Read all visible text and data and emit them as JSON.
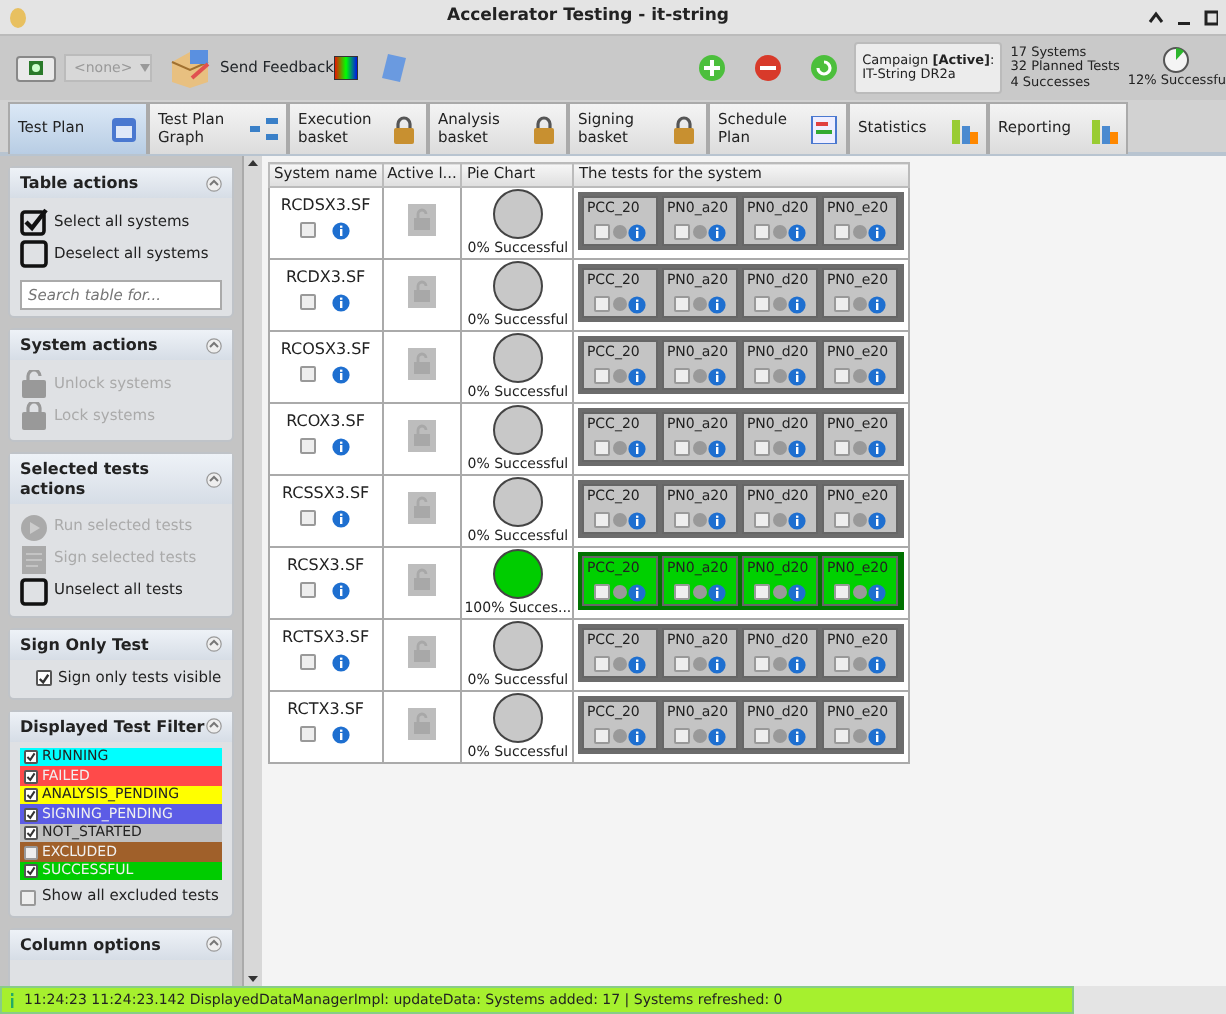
{
  "window": {
    "title": "Accelerator Testing - it-string"
  },
  "toolbar": {
    "dropdown": "<none>",
    "feedback": "Send Feedback",
    "campaign": "Campaign **[Active]**:",
    "campaign_name": "IT-String DR2a",
    "stats": [
      "17 Systems",
      "32 Planned Tests",
      "4 Successes"
    ],
    "progress_label": "12% Successfu"
  },
  "tabs": [
    {
      "label": "Test Plan",
      "selected": true
    },
    {
      "label": "Test Plan Graph",
      "selected": false
    },
    {
      "label": "Execution basket",
      "selected": false
    },
    {
      "label": "Analysis basket",
      "selected": false
    },
    {
      "label": "Signing basket",
      "selected": false
    },
    {
      "label": "Schedule Plan",
      "selected": false
    },
    {
      "label": "Statistics",
      "selected": false
    },
    {
      "label": "Reporting",
      "selected": false
    }
  ],
  "sidebar": {
    "table_actions": {
      "title": "Table actions",
      "select_all": "Select all systems",
      "deselect_all": "Deselect all systems",
      "search_placeholder": "Search table for..."
    },
    "system_actions": {
      "title": "System actions",
      "items": [
        {
          "label": "Unlock systems",
          "disabled": true
        },
        {
          "label": "Lock systems",
          "disabled": true
        }
      ]
    },
    "selected_tests_actions": {
      "title": "Selected tests actions",
      "items": [
        {
          "label": "Run selected tests",
          "disabled": true
        },
        {
          "label": "Sign selected tests",
          "disabled": true
        },
        {
          "label": "Unselect all tests",
          "disabled": false
        }
      ]
    },
    "sign_only": {
      "title": "Sign Only Test",
      "label": "Sign only tests visible",
      "checked": true
    },
    "filter": {
      "title": "Displayed Test Filter",
      "items": [
        {
          "label": "RUNNING",
          "checked": true,
          "color": "#00ffff"
        },
        {
          "label": "FAILED",
          "checked": true,
          "color": "#ff4a4a"
        },
        {
          "label": "ANALYSIS_PENDING",
          "checked": true,
          "color": "#ffff00"
        },
        {
          "label": "SIGNING_PENDING",
          "checked": true,
          "color": "#5c5ce6"
        },
        {
          "label": "NOT_STARTED",
          "checked": true,
          "color": "#c0c0c0"
        },
        {
          "label": "EXCLUDED",
          "checked": false,
          "color": "#a0602a"
        },
        {
          "label": "SUCCESSFUL",
          "checked": true,
          "color": "#00cc00"
        }
      ],
      "show_excluded": {
        "label": "Show all excluded tests",
        "checked": false
      }
    },
    "column_options": {
      "title": "Column options"
    }
  },
  "table": {
    "columns": [
      "System name",
      "Active l...",
      "Pie Chart",
      "The tests for the system"
    ],
    "rows": [
      {
        "system": "RCDSX3.SF",
        "checked": false,
        "pie_label": "0% Successful",
        "color": "#c8c8c8",
        "tests": [
          {
            "name": "PCC_20",
            "color": "#c4c4c4",
            "checked": false
          },
          {
            "name": "PN0_a20",
            "color": "#c4c4c4",
            "checked": false
          },
          {
            "name": "PN0_d20",
            "color": "#c4c4c4",
            "checked": false
          },
          {
            "name": "PN0_e20",
            "color": "#c4c4c4",
            "checked": false
          }
        ]
      },
      {
        "system": "RCDX3.SF",
        "checked": false,
        "pie_label": "0% Successful",
        "color": "#c8c8c8",
        "tests": [
          {
            "name": "PCC_20",
            "color": "#c4c4c4",
            "checked": false
          },
          {
            "name": "PN0_a20",
            "color": "#c4c4c4",
            "checked": false
          },
          {
            "name": "PN0_d20",
            "color": "#c4c4c4",
            "checked": false
          },
          {
            "name": "PN0_e20",
            "color": "#c4c4c4",
            "checked": false
          }
        ]
      },
      {
        "system": "RCOSX3.SF",
        "checked": false,
        "pie_label": "0% Successful",
        "color": "#c8c8c8",
        "tests": [
          {
            "name": "PCC_20",
            "color": "#c4c4c4",
            "checked": false
          },
          {
            "name": "PN0_a20",
            "color": "#c4c4c4",
            "checked": false
          },
          {
            "name": "PN0_d20",
            "color": "#c4c4c4",
            "checked": false
          },
          {
            "name": "PN0_e20",
            "color": "#c4c4c4",
            "checked": false
          }
        ]
      },
      {
        "system": "RCOX3.SF",
        "checked": false,
        "pie_label": "0% Successful",
        "color": "#c8c8c8",
        "tests": [
          {
            "name": "PCC_20",
            "color": "#c4c4c4",
            "checked": false
          },
          {
            "name": "PN0_a20",
            "color": "#c4c4c4",
            "checked": false
          },
          {
            "name": "PN0_d20",
            "color": "#c4c4c4",
            "checked": false
          },
          {
            "name": "PN0_e20",
            "color": "#c4c4c4",
            "checked": false
          }
        ]
      },
      {
        "system": "RCSSX3.SF",
        "checked": false,
        "pie_label": "0% Successful",
        "color": "#c8c8c8",
        "tests": [
          {
            "name": "PCC_20",
            "color": "#c4c4c4",
            "checked": false
          },
          {
            "name": "PN0_a20",
            "color": "#c4c4c4",
            "checked": false
          },
          {
            "name": "PN0_d20",
            "color": "#c4c4c4",
            "checked": false
          },
          {
            "name": "PN0_e20",
            "color": "#c4c4c4",
            "checked": false
          }
        ]
      },
      {
        "system": "RCSX3.SF",
        "checked": false,
        "pie_label": "100% Succes...",
        "color": "#00cc00",
        "tests": [
          {
            "name": "PCC_20",
            "color": "#00d000",
            "checked": false
          },
          {
            "name": "PN0_a20",
            "color": "#00d000",
            "checked": false
          },
          {
            "name": "PN0_d20",
            "color": "#00d000",
            "checked": false
          },
          {
            "name": "PN0_e20",
            "color": "#00d000",
            "checked": false
          }
        ]
      },
      {
        "system": "RCTSX3.SF",
        "checked": false,
        "pie_label": "0% Successful",
        "color": "#c8c8c8",
        "tests": [
          {
            "name": "PCC_20",
            "color": "#c4c4c4",
            "checked": false
          },
          {
            "name": "PN0_a20",
            "color": "#c4c4c4",
            "checked": false
          },
          {
            "name": "PN0_d20",
            "color": "#c4c4c4",
            "checked": false
          },
          {
            "name": "PN0_e20",
            "color": "#c4c4c4",
            "checked": false
          }
        ]
      },
      {
        "system": "RCTX3.SF",
        "checked": false,
        "pie_label": "0% Successful",
        "color": "#c8c8c8",
        "tests": [
          {
            "name": "PCC_20",
            "color": "#c4c4c4",
            "checked": false
          },
          {
            "name": "PN0_a20",
            "color": "#c4c4c4",
            "checked": false
          },
          {
            "name": "PN0_d20",
            "color": "#c4c4c4",
            "checked": false
          },
          {
            "name": "PN0_e20",
            "color": "#c4c4c4",
            "checked": false
          }
        ]
      }
    ]
  },
  "status_bar": "11:24:23 11:24:23.142 DisplayedDataManagerImpl: updateData: Systems added: 17 | Systems refreshed: 0"
}
